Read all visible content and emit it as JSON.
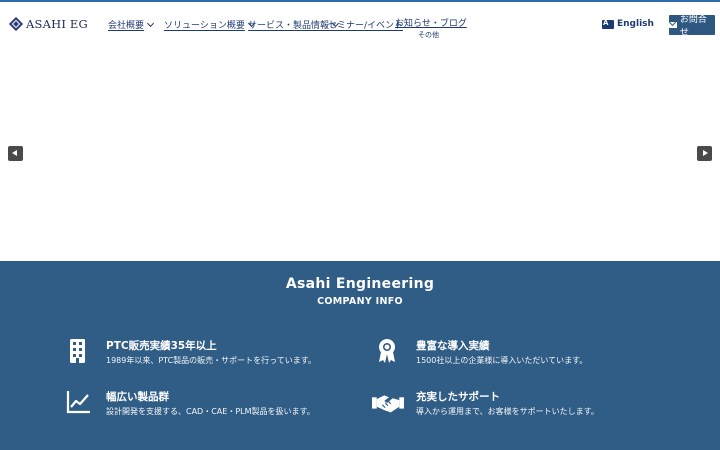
{
  "header": {
    "logo_text": "ASAHI EG",
    "nav": [
      {
        "label": "会社概要"
      },
      {
        "label": "ソリューション概要"
      },
      {
        "label": "サービス・製品情報"
      },
      {
        "label": "セミナー/イベント"
      }
    ],
    "nav_stacked": {
      "line1": "お知らせ・ブログ",
      "line2": "その他"
    },
    "lang_label": "English",
    "contact_label": "お問合せ"
  },
  "info": {
    "title": "Asahi Engineering",
    "subtitle": "COMPANY INFO",
    "features": [
      {
        "icon": "building-icon",
        "title": "PTC販売実績35年以上",
        "desc": "1989年以来、PTC製品の販売・サポートを行っています。"
      },
      {
        "icon": "award-icon",
        "title": "豊富な導入実績",
        "desc": "1500社以上の企業様に導入いただいています。"
      },
      {
        "icon": "chart-line-icon",
        "title": "幅広い製品群",
        "desc": "設計開発を支援する、CAD・CAE・PLM製品を扱います。"
      },
      {
        "icon": "handshake-icon",
        "title": "充実したサポート",
        "desc": "導入から運用まで、お客様をサポートいたします。"
      }
    ]
  }
}
